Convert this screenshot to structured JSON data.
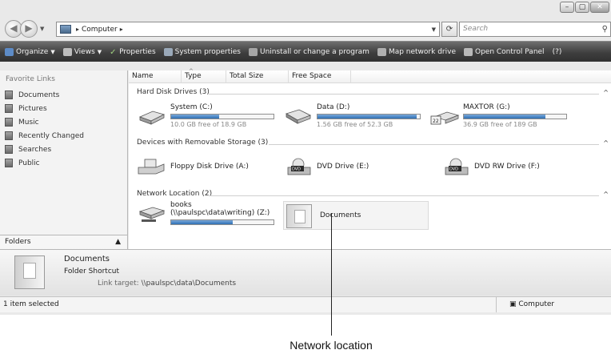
{
  "window": {
    "caption_buttons": [
      "–",
      "▢",
      "✕"
    ]
  },
  "address_bar": {
    "crumbs": [
      "Computer"
    ],
    "search_placeholder": "Search"
  },
  "toolbar": {
    "items": [
      {
        "label": "Organize",
        "dropdown": true
      },
      {
        "label": "Views",
        "dropdown": true
      },
      {
        "label": "Properties"
      },
      {
        "label": "System properties"
      },
      {
        "label": "Uninstall or change a program"
      },
      {
        "label": "Map network drive"
      },
      {
        "label": "Open Control Panel"
      }
    ]
  },
  "left_nav": {
    "title": "Favorite Links",
    "items": [
      "Documents",
      "Pictures",
      "Music",
      "Recently Changed",
      "Searches",
      "Public"
    ],
    "folders_label": "Folders"
  },
  "columns": [
    "Name",
    "Type",
    "Total Size",
    "Free Space"
  ],
  "groups": [
    {
      "title": "Hard Disk Drives (3)"
    },
    {
      "title": "Devices with Removable Storage (3)"
    },
    {
      "title": "Network Location (2)"
    }
  ],
  "hard_disks": [
    {
      "name": "System (C:)",
      "free_text": "10.0 GB free of 18.9 GB",
      "used_fraction": 0.47
    },
    {
      "name": "Data (D:)",
      "free_text": "1.56 GB free of 52.3 GB",
      "used_fraction": 0.97
    },
    {
      "name": "MAXTOR (G:)",
      "free_text": "36.9 GB free of 189 GB",
      "used_fraction": 0.8
    }
  ],
  "removable": [
    {
      "name": "Floppy Disk Drive (A:)"
    },
    {
      "name": "DVD Drive (E:)",
      "badge": "DVD"
    },
    {
      "name": "DVD RW Drive (F:)",
      "badge": "DVD"
    }
  ],
  "network": [
    {
      "name_line1": "books",
      "name_line2": "(\\\\paulspc\\data\\writing) (Z:)",
      "used_fraction": 0.6
    },
    {
      "name": "Documents"
    }
  ],
  "details": {
    "name": "Documents",
    "type": "Folder Shortcut",
    "link_label": "Link target:",
    "link_value": "\\\\paulspc\\data\\Documents"
  },
  "status": {
    "left": "1 item selected",
    "right": "Computer"
  },
  "callout": {
    "label": "Network location"
  },
  "colors": {
    "toolbar": "#3f3f3f",
    "bar_fill": "#2d6fb3"
  }
}
